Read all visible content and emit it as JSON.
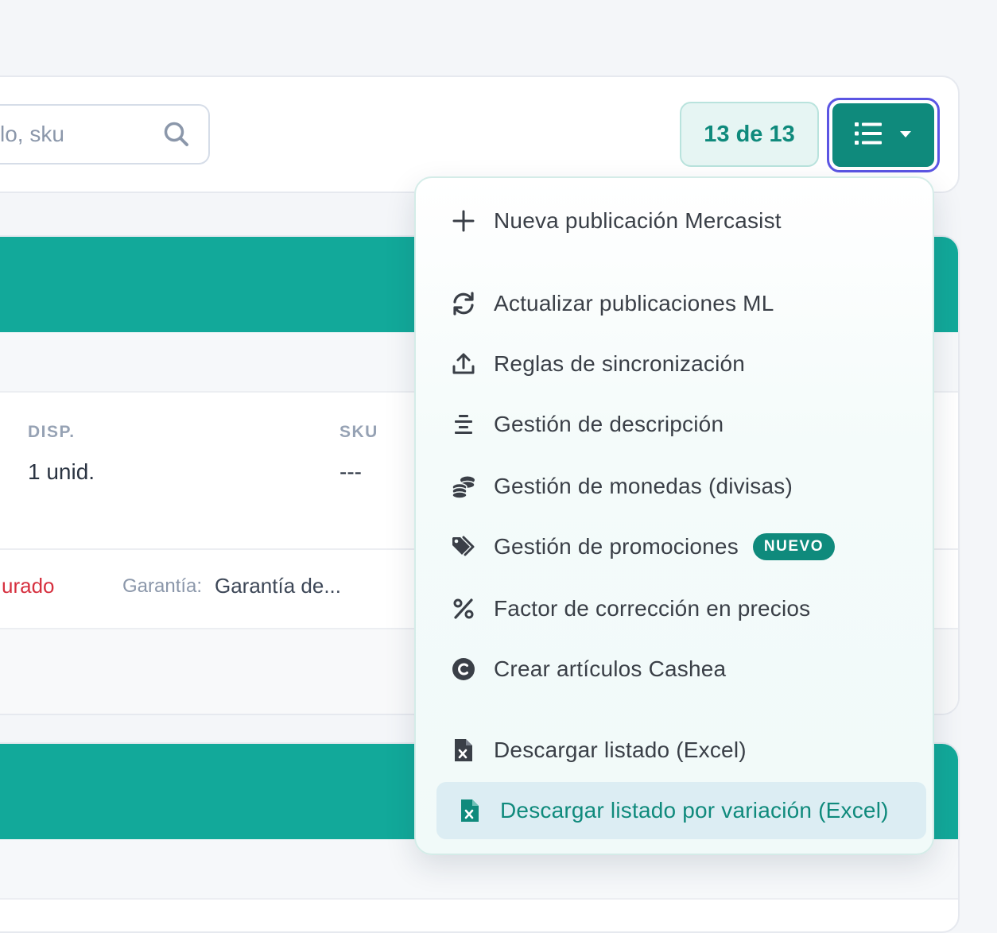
{
  "toolbar": {
    "search_placeholder": "lo, sku",
    "count_badge": "13 de 13"
  },
  "table": {
    "columns": {
      "disp": "DISP.",
      "sku": "SKU"
    },
    "row": {
      "disp": "1 unid.",
      "sku": "---"
    },
    "status_text": "urado",
    "warranty_label": "Garantía:",
    "warranty_value": "Garantía de..."
  },
  "menu": {
    "items": [
      {
        "label": "Nueva publicación Mercasist",
        "icon": "plus-icon"
      },
      {
        "label": "Actualizar publicaciones ML",
        "icon": "refresh-icon"
      },
      {
        "label": "Reglas de sincronización",
        "icon": "upload-icon"
      },
      {
        "label": "Gestión de descripción",
        "icon": "align-center-icon"
      },
      {
        "label": "Gestión de monedas (divisas)",
        "icon": "coins-icon"
      },
      {
        "label": "Gestión de promociones",
        "icon": "tags-icon",
        "badge": "NUEVO"
      },
      {
        "label": "Factor de corrección en precios",
        "icon": "percent-icon"
      },
      {
        "label": "Crear artículos Cashea",
        "icon": "c-circle-icon"
      },
      {
        "label": "Descargar listado (Excel)",
        "icon": "file-excel-icon"
      },
      {
        "label": "Descargar listado por variación (Excel)",
        "icon": "file-excel-icon"
      }
    ]
  },
  "colors": {
    "accent": "#0f8a7c",
    "header_teal": "#12a99a",
    "focus_ring": "#5b55e3",
    "status_red": "#d6303f"
  }
}
